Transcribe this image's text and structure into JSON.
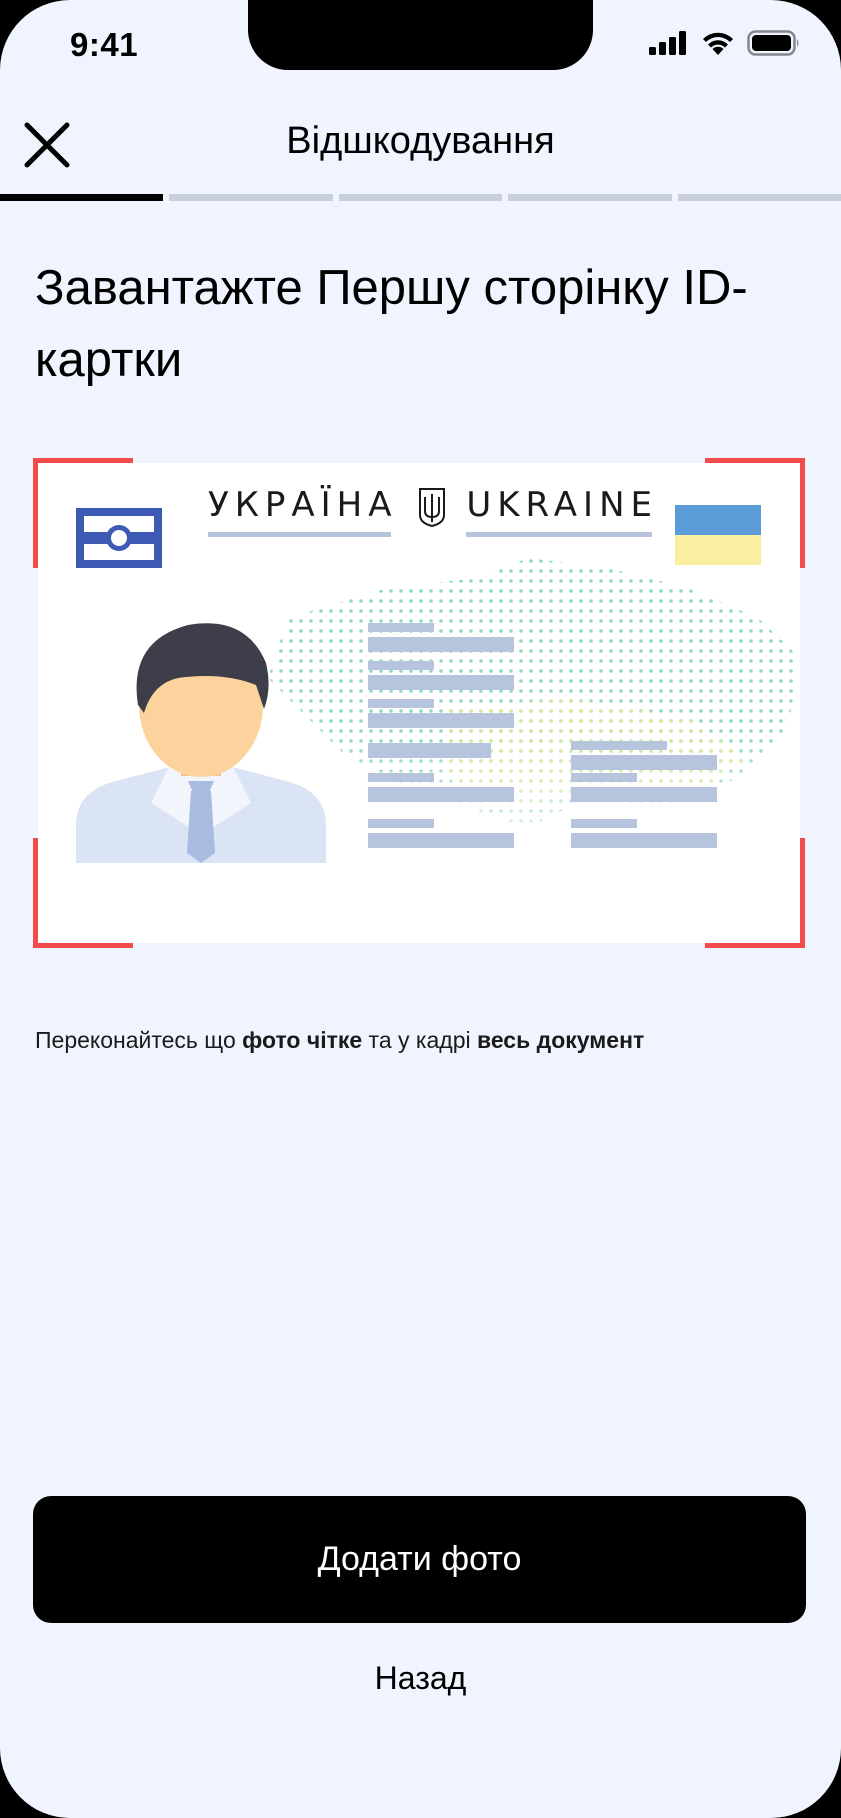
{
  "status_bar": {
    "time": "9:41",
    "icons": [
      "signal-icon",
      "wifi-icon",
      "battery-icon"
    ]
  },
  "nav": {
    "title": "Відшкодування",
    "close_icon": "close-icon"
  },
  "progress": {
    "steps_total": 5,
    "steps_done": 1
  },
  "heading": "Завантажте Першу сторінку ID-картки",
  "id_card": {
    "country_ua": "УКРАЇНА",
    "country_en": "UKRAINE",
    "emblem_icon": "trident-icon",
    "chip_icon": "id-chip-icon",
    "flag_colors": [
      "#5b9bd8",
      "#faeea0"
    ],
    "frame_color": "#f24b4b"
  },
  "hint": {
    "part1": "Переконайтесь що ",
    "bold1": "фото чітке",
    "part2": " та у кадрі ",
    "bold2": "весь документ"
  },
  "primary_button": {
    "label": "Додати фото"
  },
  "back_link": {
    "label": "Назад"
  }
}
